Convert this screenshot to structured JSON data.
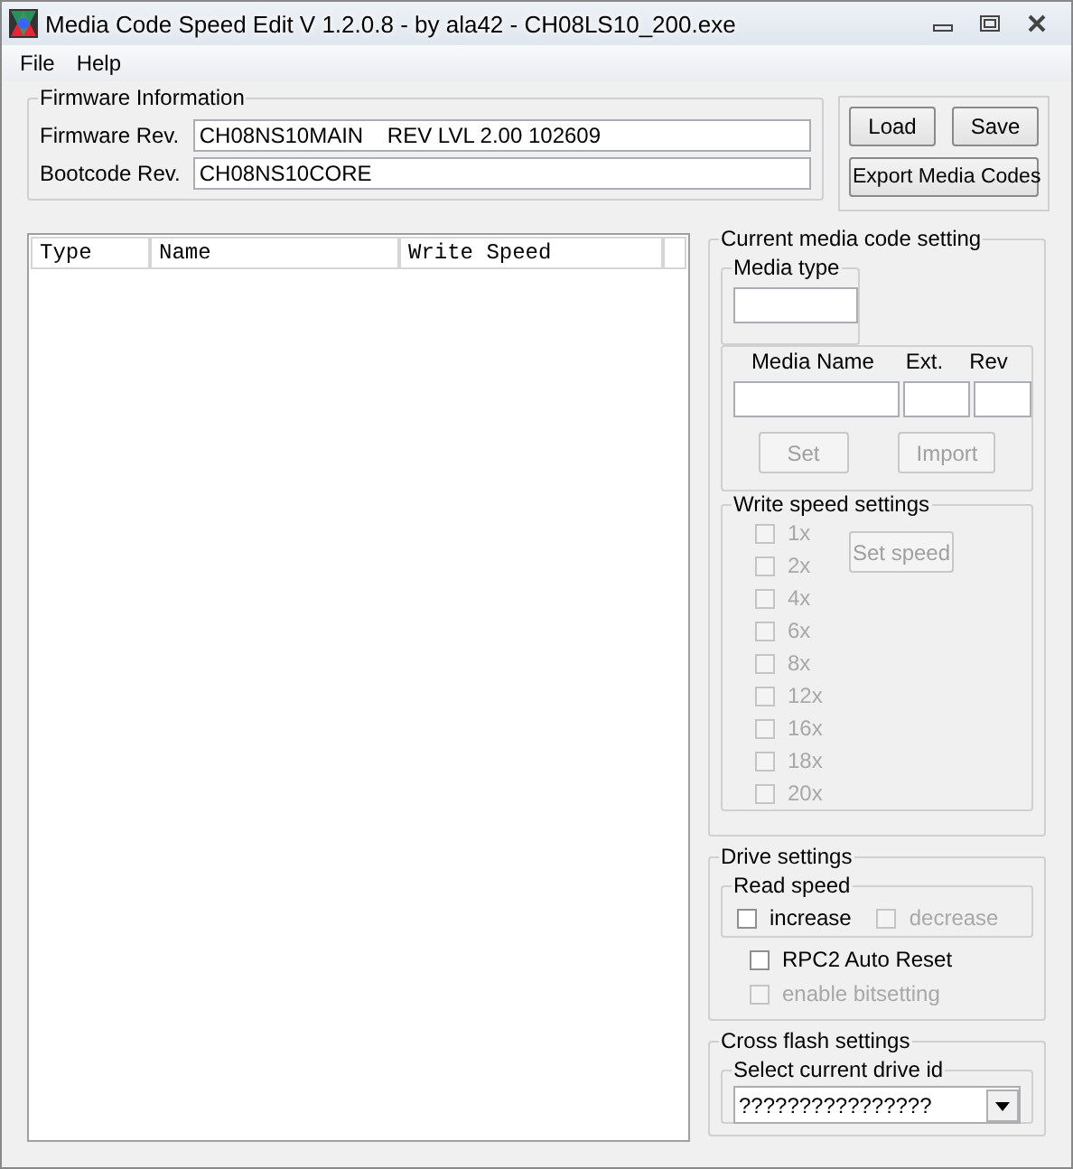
{
  "window": {
    "title": "Media Code Speed Edit V 1.2.0.8 - by ala42 - CH08LS10_200.exe"
  },
  "menu": [
    "File",
    "Help"
  ],
  "firmware": {
    "legend": "Firmware Information",
    "fields": [
      {
        "label": "Firmware Rev.",
        "value": "CH08NS10MAIN    REV LVL 2.00 102609"
      },
      {
        "label": "Bootcode Rev.",
        "value": "CH08NS10CORE"
      }
    ]
  },
  "file_buttons": [
    {
      "label": "Load",
      "disabled": false
    },
    {
      "label": "Save",
      "disabled": false
    },
    {
      "label": "Export Media Codes",
      "disabled": false
    }
  ],
  "table": {
    "columns": [
      "Type",
      "Name",
      "Write Speed"
    ]
  },
  "media": {
    "legend": "Current media code setting",
    "type_legend": "Media type",
    "name_label": "Media Name",
    "ext_label": "Ext.",
    "rev_label": "Rev",
    "buttons": [
      {
        "label": "Set",
        "disabled": true
      },
      {
        "label": "Import",
        "disabled": true
      }
    ]
  },
  "write_speed": {
    "legend": "Write speed settings",
    "button": {
      "label": "Set speed",
      "disabled": true
    },
    "speeds": [
      {
        "label": "1x",
        "checked": false,
        "disabled": true
      },
      {
        "label": "2x",
        "checked": false,
        "disabled": true
      },
      {
        "label": "4x",
        "checked": false,
        "disabled": true
      },
      {
        "label": "6x",
        "checked": false,
        "disabled": true
      },
      {
        "label": "8x",
        "checked": false,
        "disabled": true
      },
      {
        "label": "12x",
        "checked": false,
        "disabled": true
      },
      {
        "label": "16x",
        "checked": false,
        "disabled": true
      },
      {
        "label": "18x",
        "checked": false,
        "disabled": true
      },
      {
        "label": "20x",
        "checked": false,
        "disabled": true
      }
    ]
  },
  "drive": {
    "legend": "Drive settings",
    "read_legend": "Read speed",
    "read_options": [
      {
        "label": "increase",
        "checked": false,
        "disabled": false
      },
      {
        "label": "decrease",
        "checked": false,
        "disabled": true
      }
    ],
    "options": [
      {
        "label": "RPC2 Auto Reset",
        "checked": false,
        "disabled": false
      },
      {
        "label": "enable bitsetting",
        "checked": false,
        "disabled": true
      }
    ]
  },
  "cross_flash": {
    "legend": "Cross flash settings",
    "select_legend": "Select current drive id",
    "value": "????????????????"
  }
}
